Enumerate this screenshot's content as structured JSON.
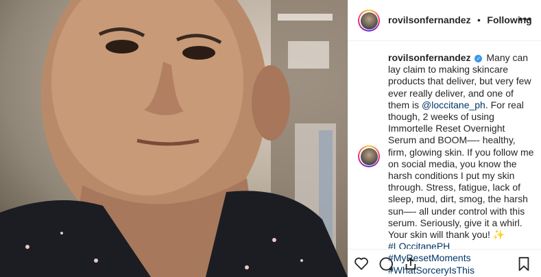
{
  "post": {
    "username": "rovilsonfernandez",
    "follow_separator": "•",
    "follow_status": "Following",
    "more_label": "•••"
  },
  "caption": {
    "username": "rovilsonfernandez",
    "text_1": "Many can lay claim to making skincare products that deliver, but very few ever really deliver, and one of them is",
    "mention": "@loccitane_ph",
    "text_2": ". For real though, 2 weeks of using Immortelle Reset Overnight Serum and BOOM—- healthy, firm, glowing skin. If you follow me on social media, you know the harsh conditions I put my skin through. Stress, fatigue, lack of sleep, mud, dirt, smog, the harsh sun—- all under control with this serum. Seriously, give it a whirl. Your skin will thank you!",
    "emoji": "✨",
    "hashtags": [
      "#LOccitanePH",
      "#MyResetMoments",
      "#WhatSorceryIsThis"
    ]
  },
  "icons": [
    "heart-icon",
    "comment-icon",
    "share-icon",
    "bookmark-icon",
    "verified-badge-icon",
    "more-options-icon"
  ],
  "colors": {
    "link": "#003569",
    "verified": "#3897f0",
    "border": "#efefef",
    "text": "#262626"
  }
}
